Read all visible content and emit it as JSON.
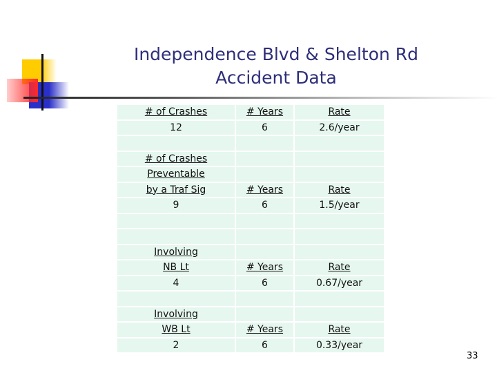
{
  "slide": {
    "title_line1": "Independence Blvd & Shelton Rd",
    "title_line2": "Accident Data",
    "page_number": "33"
  },
  "table": {
    "rows": [
      [
        "# of Crashes",
        "# Years",
        "Rate"
      ],
      [
        "12",
        "6",
        "2.6/year"
      ],
      [
        "",
        "",
        ""
      ],
      [
        "# of Crashes",
        "",
        ""
      ],
      [
        "Preventable",
        "",
        ""
      ],
      [
        "by a Traf Sig",
        "# Years",
        "Rate"
      ],
      [
        "9",
        "6",
        "1.5/year"
      ],
      [
        "",
        "",
        ""
      ],
      [
        "",
        "",
        ""
      ],
      [
        "Involving",
        "",
        ""
      ],
      [
        "NB Lt",
        "# Years",
        "Rate"
      ],
      [
        "4",
        "6",
        "0.67/year"
      ],
      [
        "",
        "",
        ""
      ],
      [
        "Involving",
        "",
        ""
      ],
      [
        "WB Lt",
        "# Years",
        "Rate"
      ],
      [
        "2",
        "6",
        "0.33/year"
      ]
    ],
    "underlined_rows": [
      0,
      3,
      4,
      5,
      9,
      10,
      13,
      14
    ]
  },
  "colors": {
    "title": "#2e2e7a",
    "cell_background": "#e6f7ef"
  }
}
